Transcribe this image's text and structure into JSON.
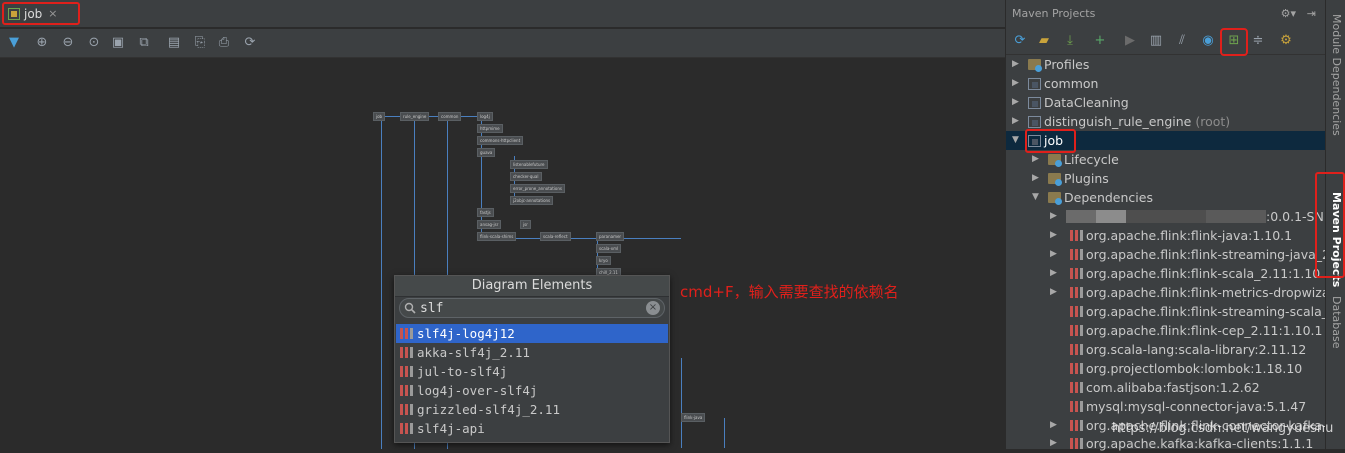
{
  "editor": {
    "tab_label": "job",
    "tab_close": "×"
  },
  "diagram": {
    "nodes": [
      "job",
      "rule_engine",
      "common",
      "log4j",
      "httpmime",
      "commons-httpclient",
      "guava",
      "listenablefuture",
      "checker-qual",
      "error_prone_annotations",
      "j2objc-annotations",
      "fastjs",
      "ansag-jsr",
      "jsr",
      "flink-scala-shims",
      "scala-reflect",
      "paranamer",
      "scala-xml",
      "kryo",
      "chill_2.11",
      "flink-java"
    ]
  },
  "popup": {
    "title": "Diagram Elements",
    "search_value": "slf",
    "results": [
      {
        "label": "slf4j-log4j12",
        "selected": true
      },
      {
        "label": "akka-slf4j_2.11",
        "selected": false
      },
      {
        "label": "jul-to-slf4j",
        "selected": false
      },
      {
        "label": "log4j-over-slf4j",
        "selected": false
      },
      {
        "label": "grizzled-slf4j_2.11",
        "selected": false
      },
      {
        "label": "slf4j-api",
        "selected": false
      }
    ]
  },
  "annotation": "cmd+F，输入需要查找的依赖名",
  "maven": {
    "title": "Maven Projects",
    "tree": [
      {
        "label": "Profiles",
        "suffix": ""
      },
      {
        "label": "common",
        "suffix": ""
      },
      {
        "label": "DataCleaning",
        "suffix": ""
      },
      {
        "label": "distinguish_rule_engine",
        "suffix": "(root)"
      },
      {
        "label": "job",
        "suffix": ""
      },
      {
        "label": "Lifecycle",
        "suffix": ""
      },
      {
        "label": "Plugins",
        "suffix": ""
      },
      {
        "label": "Dependencies",
        "suffix": ""
      }
    ],
    "dependencies": [
      ":0.0.1-SN",
      "org.apache.flink:flink-java:1.10.1",
      "org.apache.flink:flink-streaming-java_2.1",
      "org.apache.flink:flink-scala_2.11:1.10.1",
      "org.apache.flink:flink-metrics-dropwizard",
      "org.apache.flink:flink-streaming-scala_2.",
      "org.apache.flink:flink-cep_2.11:1.10.1",
      "org.scala-lang:scala-library:2.11.12",
      "org.projectlombok:lombok:1.18.10",
      "com.alibaba:fastjson:1.2.62",
      "mysql:mysql-connector-java:5.1.47",
      "org.apache.flink:flink-connector-kafka-2",
      "org.apache.kafka:kafka-clients:1.1.1"
    ]
  },
  "side_tabs": {
    "module_dependencies": "Module Dependencies",
    "maven_projects": "Maven Projects",
    "database": "Database"
  },
  "watermark": "https://blog.csdn.net/wangyuesnu",
  "colors": {
    "background": "#2b2b2b",
    "panel": "#3c3f41",
    "selection": "#2f65ca",
    "highlight_box": "#e0201b"
  }
}
